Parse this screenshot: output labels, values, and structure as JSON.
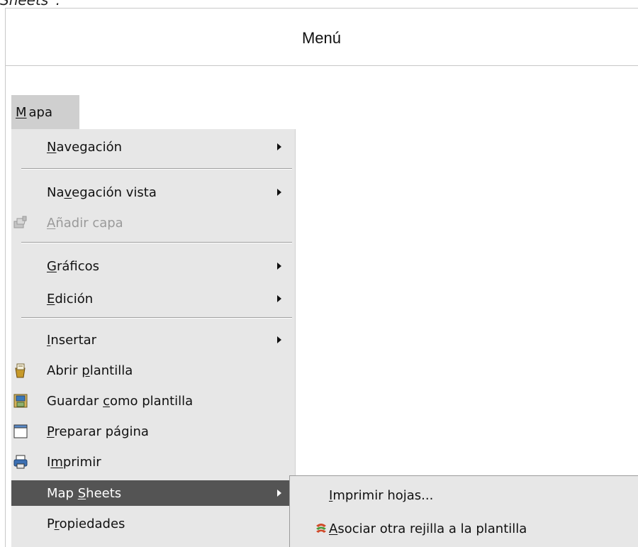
{
  "caption": {
    "text": "Sheets”."
  },
  "table": {
    "header": "Menú"
  },
  "menubar": {
    "label_pre": "",
    "label_u": "M",
    "label_post": "apa"
  },
  "menu": {
    "items": [
      {
        "pre": "",
        "u": "N",
        "post": "avegación",
        "submenu": true
      },
      {
        "pre": "Na",
        "u": "v",
        "post": "egación vista",
        "submenu": true
      },
      {
        "pre": "",
        "u": "A",
        "post": "ñadir capa",
        "disabled": true,
        "icon": "add-layer-icon"
      },
      {
        "pre": "",
        "u": "G",
        "post": "ráficos",
        "submenu": true
      },
      {
        "pre": "",
        "u": "E",
        "post": "dición",
        "submenu": true
      },
      {
        "pre": "",
        "u": "I",
        "post": "nsertar",
        "submenu": true
      },
      {
        "pre": "Abrir ",
        "u": "p",
        "post": "lantilla",
        "icon": "open-template-icon"
      },
      {
        "pre": "Guardar ",
        "u": "c",
        "post": "omo plantilla",
        "icon": "save-template-icon"
      },
      {
        "pre": "",
        "u": "P",
        "post": "reparar página",
        "icon": "page-setup-icon"
      },
      {
        "pre": "I",
        "u": "m",
        "post": "primir",
        "icon": "print-icon"
      },
      {
        "pre": "Map ",
        "u": "S",
        "post": "heets",
        "submenu": true,
        "highlighted": true
      },
      {
        "pre": "P",
        "u": "r",
        "post": "opiedades"
      }
    ]
  },
  "submenu": {
    "items": [
      {
        "pre": "",
        "u": "I",
        "post": "mprimir hojas..."
      },
      {
        "pre": "",
        "u": "A",
        "post": "sociar otra rejilla a la plantilla",
        "icon": "grid-icon"
      }
    ]
  }
}
